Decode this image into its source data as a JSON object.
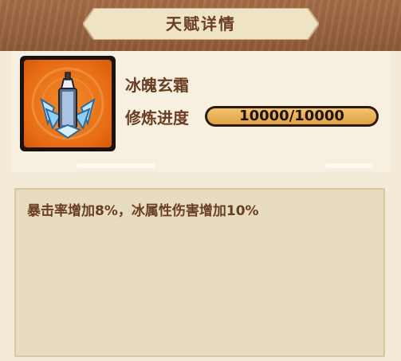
{
  "header": {
    "title": "天赋详情"
  },
  "talent": {
    "name": "冰魄玄霜",
    "icon": "ice-crystal-sword-icon",
    "progress_label": "修炼进度",
    "progress_text": "10000/10000",
    "progress_fraction": 1.0
  },
  "description": {
    "text": "暴击率增加8%，冰属性伤害增加10%"
  },
  "colors": {
    "header_bg": "#8e5a3a",
    "title_text": "#6a3e22",
    "icon_bg": "#e86d14",
    "progress_fill": "#e0a245",
    "panel_bg": "#f7f0e1",
    "desc_bg": "#e8dcc0"
  }
}
